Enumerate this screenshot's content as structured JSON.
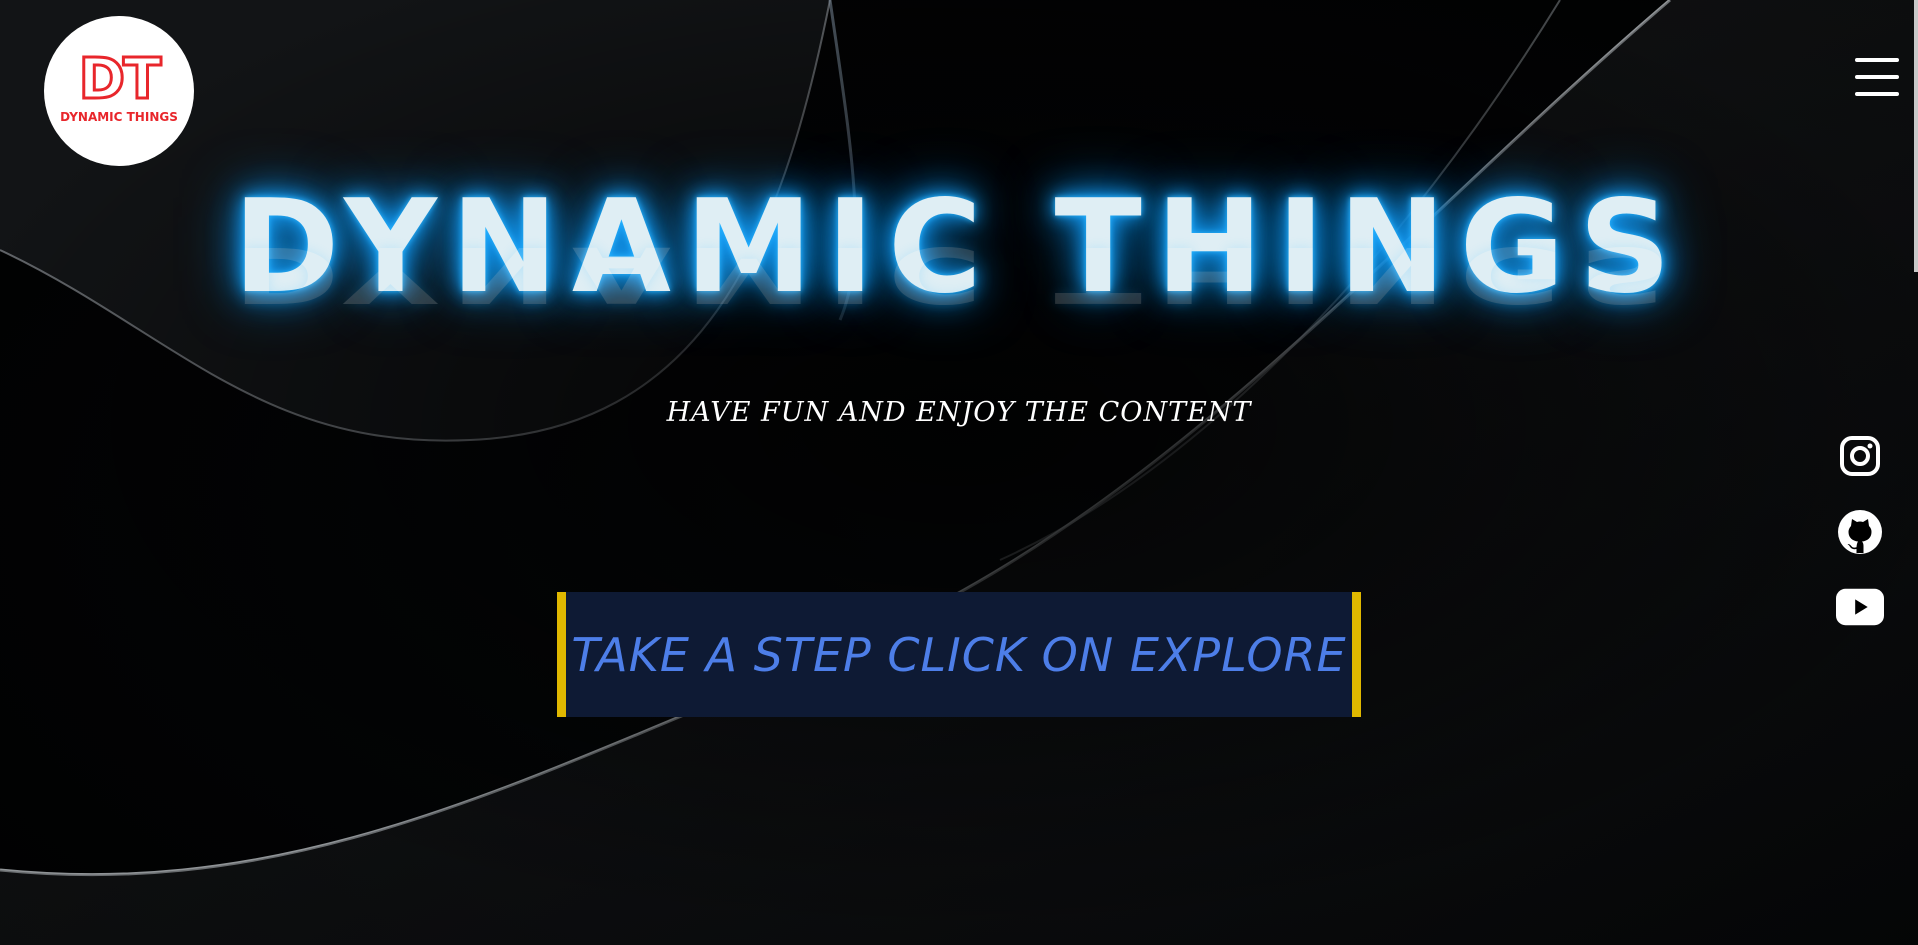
{
  "brand": {
    "logo_mark": "DT",
    "logo_text": "DYNAMIC THINGS",
    "accent_color": "#e8262b"
  },
  "header": {
    "menu_icon": "hamburger-menu-icon"
  },
  "hero": {
    "title": "DYNAMIC THINGS",
    "tagline": "HAVE FUN AND ENJOY THE CONTENT",
    "glow_color": "#1aa3ff",
    "cta_label": "TAKE A STEP CLICK ON EXPLORE",
    "cta_text_color": "#4d7ee8",
    "cta_border_color": "#e0b800"
  },
  "social": [
    {
      "icon": "instagram-icon"
    },
    {
      "icon": "github-icon"
    },
    {
      "icon": "youtube-icon"
    }
  ]
}
